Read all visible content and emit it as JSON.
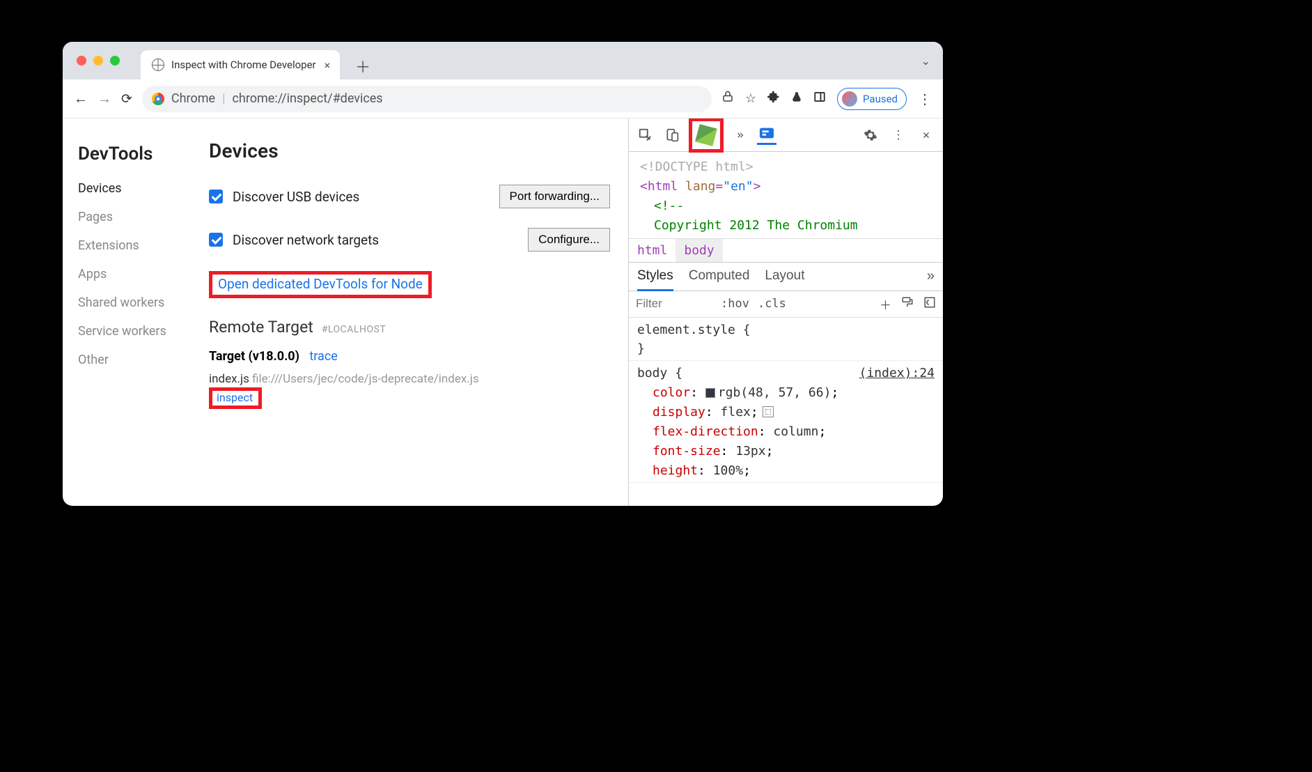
{
  "tab": {
    "title": "Inspect with Chrome Developer"
  },
  "omnibar": {
    "scheme_label": "Chrome",
    "url": "chrome://inspect/#devices"
  },
  "toolbar": {
    "paused_label": "Paused"
  },
  "sidebar": {
    "title": "DevTools",
    "items": [
      "Devices",
      "Pages",
      "Extensions",
      "Apps",
      "Shared workers",
      "Service workers",
      "Other"
    ],
    "activeIndex": 0
  },
  "content": {
    "heading": "Devices",
    "usb_label": "Discover USB devices",
    "usb_checked": true,
    "port_forwarding_btn": "Port forwarding...",
    "network_label": "Discover network targets",
    "network_checked": true,
    "configure_btn": "Configure...",
    "node_link": "Open dedicated DevTools for Node",
    "remote_heading": "Remote Target",
    "remote_sub": "#LOCALHOST",
    "target_name": "Target (v18.0.0)",
    "trace_label": "trace",
    "file_name": "index.js",
    "file_path": "file:///Users/jec/code/js-deprecate/index.js",
    "inspect_label": "inspect"
  },
  "devtools": {
    "dom": {
      "line1": "<!DOCTYPE html>",
      "line2_open": "<html",
      "line2_attr": "lang",
      "line2_val": "\"en\"",
      "line2_close": ">",
      "line3": "<!--",
      "line4": "Copyright 2012 The Chromium"
    },
    "crumbs": [
      "html",
      "body"
    ],
    "style_tabs": [
      "Styles",
      "Computed",
      "Layout"
    ],
    "filter_placeholder": "Filter",
    "hov": ":hov",
    "cls": ".cls",
    "elem_style_open": "element.style {",
    "elem_style_close": "}",
    "body_rule": {
      "selector": "body",
      "open": "{",
      "source": "(index):24",
      "decls": [
        {
          "prop": "color",
          "val": "rgb(48, 57, 66)",
          "swatch": true
        },
        {
          "prop": "display",
          "val": "flex",
          "grid": true
        },
        {
          "prop": "flex-direction",
          "val": "column"
        },
        {
          "prop": "font-size",
          "val": "13px"
        },
        {
          "prop": "height",
          "val": "100%"
        }
      ]
    }
  }
}
